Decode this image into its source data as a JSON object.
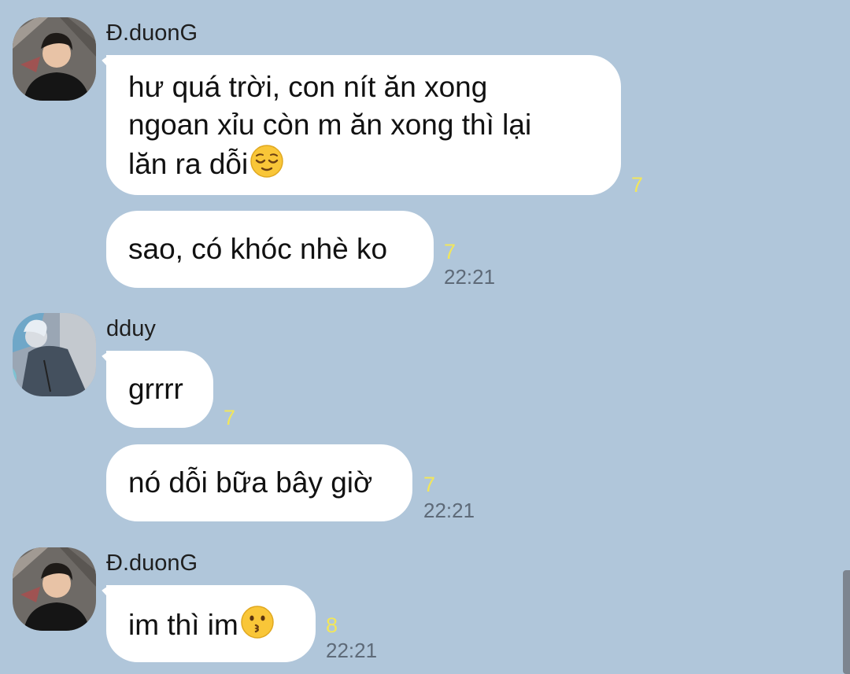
{
  "chat": {
    "messages": [
      {
        "sender": "Đ.duonG",
        "text_lines": [
          "hư quá trời, con nít ăn xong",
          "ngoan xỉu còn m ăn xong thì lại",
          "lăn ra dỗi"
        ],
        "emoji": "relieved-face",
        "read_count": "7",
        "time": ""
      },
      {
        "sender": "",
        "text": "sao, có khóc nhè ko",
        "read_count": "7",
        "time": "22:21"
      },
      {
        "sender": "dduy",
        "text": "grrrr",
        "read_count": "7",
        "time": ""
      },
      {
        "sender": "",
        "text": "nó dỗi bữa bây giờ",
        "read_count": "7",
        "time": "22:21"
      },
      {
        "sender": "Đ.duonG",
        "text": "im thì im",
        "emoji": "kissing-face",
        "read_count": "8",
        "time": "22:21"
      }
    ]
  }
}
